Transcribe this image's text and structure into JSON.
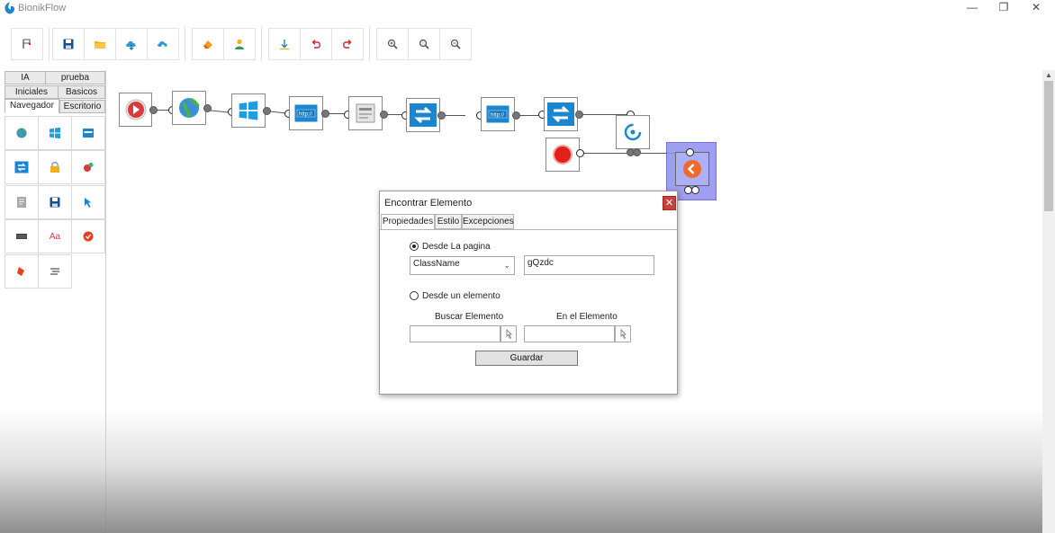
{
  "window": {
    "title": "BionikFlow",
    "controls": [
      "—",
      "❐",
      "✕"
    ]
  },
  "toolbar": {
    "buttons": [
      {
        "icon": "flag-icon"
      },
      {
        "icon": "save-icon"
      },
      {
        "icon": "folder-open-icon"
      },
      {
        "icon": "cloud-download-icon"
      },
      {
        "icon": "cloud-upload-icon"
      },
      {
        "icon": "eraser-icon"
      },
      {
        "icon": "user-icon"
      },
      {
        "icon": "arrow-down-icon"
      },
      {
        "icon": "undo-icon"
      },
      {
        "icon": "redo-icon"
      },
      {
        "icon": "zoom-in-icon"
      },
      {
        "icon": "zoom-reset-icon"
      },
      {
        "icon": "zoom-out-icon"
      }
    ]
  },
  "palette": {
    "tabs_row1": [
      "IA",
      "prueba"
    ],
    "tabs_row2": [
      "Iniciales",
      "Basicos"
    ],
    "tabs_row3": [
      "Navegador",
      "Escritorio"
    ],
    "active_tab": "Navegador",
    "items": [
      {
        "icon": "globe-icon"
      },
      {
        "icon": "windows-icon"
      },
      {
        "icon": "browser-window-icon"
      },
      {
        "icon": "switch-tab-icon"
      },
      {
        "icon": "lock-icon"
      },
      {
        "icon": "plugin-icon"
      },
      {
        "icon": "document-icon"
      },
      {
        "icon": "save-icon"
      },
      {
        "icon": "cursor-click-icon"
      },
      {
        "icon": "keyboard-icon"
      },
      {
        "icon": "text-icon",
        "text": "Aa"
      },
      {
        "icon": "check-circle-icon"
      },
      {
        "icon": "eraser-icon"
      },
      {
        "icon": "list-icon"
      }
    ]
  },
  "flow": {
    "nodes": [
      {
        "icon": "play-icon"
      },
      {
        "icon": "globe-icon"
      },
      {
        "icon": "windows-icon"
      },
      {
        "icon": "browser-url-icon",
        "text": "http://"
      },
      {
        "icon": "form-icon"
      },
      {
        "icon": "switch-tab-icon"
      },
      {
        "icon": "browser-url-icon",
        "text": "http://"
      },
      {
        "icon": "switch-tab-icon"
      },
      {
        "icon": "loop-icon"
      },
      {
        "icon": "stop-icon"
      },
      {
        "icon": "back-arrow-icon"
      }
    ]
  },
  "dialog": {
    "title": "Encontrar Elemento",
    "close": "✕",
    "tabs": [
      "Propiedades",
      "Estilo",
      "Excepciones"
    ],
    "active_tab": "Propiedades",
    "radio_page": "Desde La pagina",
    "radio_page_selected": true,
    "selector_type": "ClassName",
    "selector_value": "gQzdc",
    "radio_element": "Desde un elemento",
    "radio_element_selected": false,
    "search_label": "Buscar Elemento",
    "in_element_label": "En el Elemento",
    "search_value": "",
    "in_element_value": "",
    "save_label": "Guardar"
  },
  "colors": {
    "accent_blue": "#1a86d0",
    "stop_red": "#e0201b",
    "close_red": "#c8413b",
    "selected_node": "#8f8ff0"
  }
}
